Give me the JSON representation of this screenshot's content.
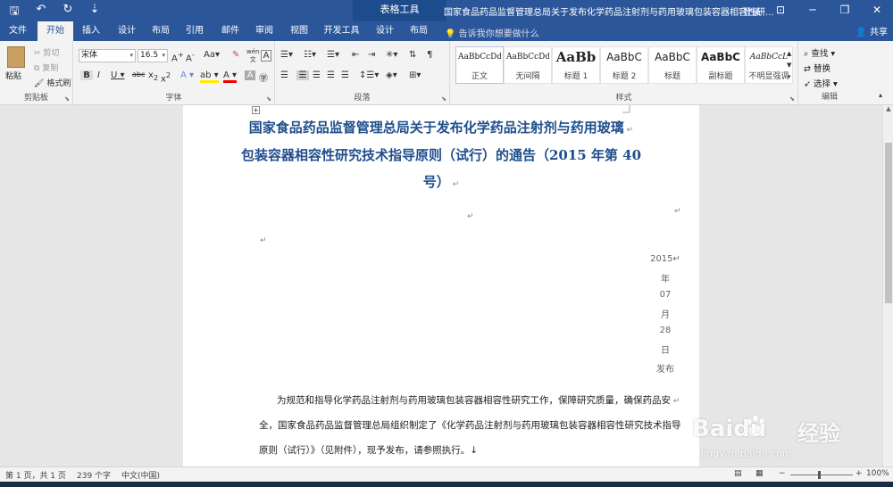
{
  "titlebar": {
    "contextual_group": "表格工具",
    "window_title": "国家食品药品监督管理总局关于发布化学药品注射剂与药用玻璃包装容器相容性研...",
    "login": "登录"
  },
  "tabs": [
    {
      "label": "文件"
    },
    {
      "label": "开始"
    },
    {
      "label": "插入"
    },
    {
      "label": "设计"
    },
    {
      "label": "布局"
    },
    {
      "label": "引用"
    },
    {
      "label": "邮件"
    },
    {
      "label": "审阅"
    },
    {
      "label": "视图"
    },
    {
      "label": "开发工具"
    },
    {
      "label": "设计"
    },
    {
      "label": "布局"
    }
  ],
  "tell_me": "告诉我你想要做什么",
  "share": "共享",
  "clipboard": {
    "paste": "粘贴",
    "cut": "剪切",
    "copy": "复制",
    "format_painter": "格式刷",
    "label": "剪贴板"
  },
  "font": {
    "name": "宋体",
    "size": "16.5",
    "case_btn": "Aa",
    "label": "字体"
  },
  "paragraph": {
    "label": "段落"
  },
  "styles": {
    "label": "样式",
    "items": [
      {
        "sample": "AaBbCcDd",
        "name": "正文"
      },
      {
        "sample": "AaBbCcDd",
        "name": "无间隔"
      },
      {
        "sample": "AaBb",
        "name": "标题 1"
      },
      {
        "sample": "AaBbC",
        "name": "标题 2"
      },
      {
        "sample": "AaBbC",
        "name": "标题"
      },
      {
        "sample": "AaBbC",
        "name": "副标题"
      },
      {
        "sample": "AaBbCcL",
        "name": "不明显强调"
      }
    ]
  },
  "editing": {
    "find": "查找",
    "replace": "替换",
    "select": "选择",
    "label": "编辑"
  },
  "document": {
    "title_lines": [
      "国家食品药品监督管理总局关于发布化学药品注射剂与药用玻璃",
      "包装容器相容性研究技术指导原则（试行）的通告（2015 年第 40",
      "号）"
    ],
    "date_parts": [
      "2015",
      "年",
      "07",
      "月",
      "28",
      "日",
      "发布"
    ],
    "body_lines": [
      "为规范和指导化学药品注射剂与药用玻璃包装容器相容性研究工作，保障研究质量，确保药品安",
      "全，国家食品药品监督管理总局组织制定了《化学药品注射剂与药用玻璃包装容器相容性研究技术指导",
      "原则（试行）》（见附件），现予发布，请参照执行。↓"
    ]
  },
  "statusbar": {
    "page": "第 1 页，共 1 页",
    "words": "239 个字",
    "language": "中文(中国)",
    "zoom": "100%"
  },
  "watermark": {
    "brand": "Baidu",
    "suffix": "经验",
    "url": "jingyan.baidu.com"
  }
}
